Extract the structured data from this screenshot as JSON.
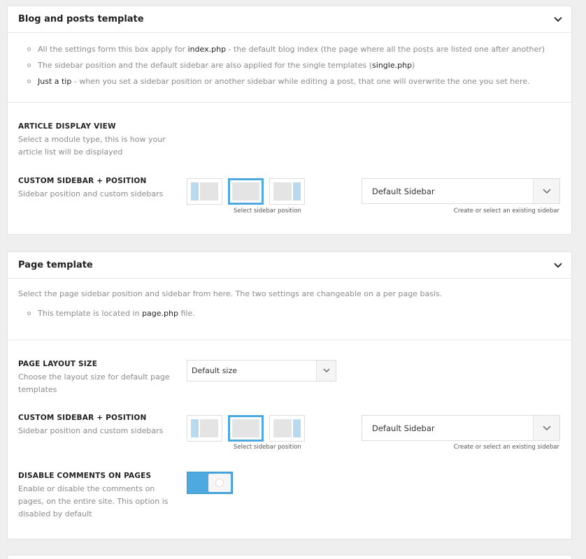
{
  "blog_panel": {
    "title": "Blog and posts template",
    "bullets": [
      {
        "pre": "All the settings form this box apply for ",
        "bold": "index.php",
        "post": " - the default blog index (the page where all the posts are listed one after another)"
      },
      {
        "pre": "The sidebar position and the default sidebar are also applied for the single templates (",
        "bold": "single.php",
        "post": ")"
      },
      {
        "pre": "",
        "bold": "Just a tip",
        "post": " - when you set a sidebar position or another sidebar while editing a post, that one will overwrite the one you set here."
      }
    ],
    "article_display": {
      "label": "ARTICLE DISPLAY VIEW",
      "desc": "Select a module type, this is how your article list will be displayed"
    },
    "sidebar": {
      "label": "CUSTOM SIDEBAR + POSITION",
      "desc": "Sidebar position and custom sidebars",
      "position_caption": "Select sidebar position",
      "selected_position": "no-sidebar",
      "select_value": "Default Sidebar",
      "select_caption": "Create or select an existing sidebar"
    }
  },
  "page_panel": {
    "title": "Page template",
    "intro": "Select the page sidebar position and sidebar from here. The two settings are changeable on a per page basis.",
    "bullets": [
      {
        "pre": "This template is located in ",
        "bold": "page.php",
        "post": " file."
      }
    ],
    "layout_size": {
      "label": "PAGE LAYOUT SIZE",
      "desc": "Choose the layout size for default page templates",
      "select_value": "Default size"
    },
    "sidebar": {
      "label": "CUSTOM SIDEBAR + POSITION",
      "desc": "Sidebar position and custom sidebars",
      "position_caption": "Select sidebar position",
      "selected_position": "no-sidebar",
      "select_value": "Default Sidebar",
      "select_caption": "Create or select an existing sidebar"
    },
    "comments": {
      "label": "DISABLE COMMENTS ON PAGES",
      "desc": "Enable or disable the comments on pages, on the entire site. This option is disabled by default",
      "toggle_on": true
    }
  },
  "colors": {
    "accent": "#4ea9e0",
    "sidebar_block": "#b9d9ee"
  }
}
